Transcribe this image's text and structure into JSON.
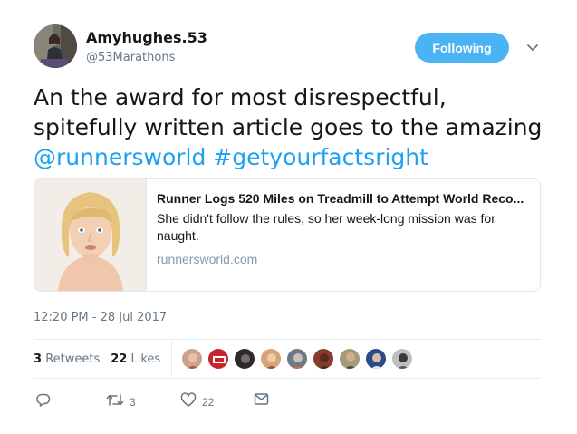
{
  "user": {
    "display_name": "Amyhughes.53",
    "handle": "@53Marathons",
    "follow_label": "Following",
    "follow_color": "#4ab3f4"
  },
  "tweet": {
    "text_plain": "An the award for most disrespectful, spitefully written article goes to the amazing",
    "mention": "@runnersworld",
    "hashtag": "#getyourfactsright",
    "link_color": "#1da1f2"
  },
  "card": {
    "title": "Runner Logs 520 Miles on Treadmill to Attempt World Reco...",
    "description": "She didn't follow the rules, so her week-long mission was for naught.",
    "domain": "runnersworld.com"
  },
  "timestamp": "12:20 PM - 28 Jul 2017",
  "stats": {
    "retweets_count": "3",
    "retweets_label": "Retweets",
    "likes_count": "22",
    "likes_label": "Likes"
  },
  "liker_avatars": [
    "avatar-1",
    "avatar-2",
    "avatar-3",
    "avatar-4",
    "avatar-5",
    "avatar-6",
    "avatar-7",
    "avatar-8",
    "avatar-9"
  ],
  "actions": {
    "reply_icon": "reply-icon",
    "retweet_icon": "retweet-icon",
    "retweet_count": "3",
    "like_icon": "heart-icon",
    "like_count": "22",
    "dm_icon": "envelope-icon"
  }
}
